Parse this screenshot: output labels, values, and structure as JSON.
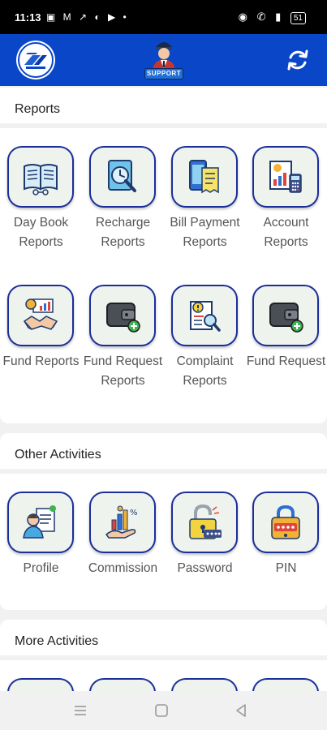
{
  "status_bar": {
    "time": "11:13",
    "battery": "51"
  },
  "header": {
    "support_badge": "SUPPORT"
  },
  "sections": {
    "reports": {
      "title": "Reports",
      "tiles": [
        {
          "label": "Day Book Reports",
          "icon": "book-icon"
        },
        {
          "label": "Recharge Reports",
          "icon": "clock-search-icon"
        },
        {
          "label": "Bill Payment Reports",
          "icon": "phone-bill-icon"
        },
        {
          "label": "Account Reports",
          "icon": "calculator-chart-icon"
        },
        {
          "label": "Fund Reports",
          "icon": "handshake-icon"
        },
        {
          "label": "Fund Request Reports",
          "icon": "wallet-add-icon"
        },
        {
          "label": "Complaint Reports",
          "icon": "document-search-icon"
        },
        {
          "label": "Fund Request",
          "icon": "wallet-add-icon"
        }
      ]
    },
    "other_activities": {
      "title": "Other Activities",
      "tiles": [
        {
          "label": "Profile",
          "icon": "profile-card-icon"
        },
        {
          "label": "Commission",
          "icon": "commission-chart-icon"
        },
        {
          "label": "Password",
          "icon": "padlock-icon"
        },
        {
          "label": "PIN",
          "icon": "pin-lock-icon"
        }
      ]
    },
    "more_activities": {
      "title": "More Activities"
    }
  },
  "colors": {
    "appbar": "#0a46c8",
    "tile_border": "#1b2f9b",
    "tile_fill": "#eef3ee",
    "label_text": "#555555"
  }
}
